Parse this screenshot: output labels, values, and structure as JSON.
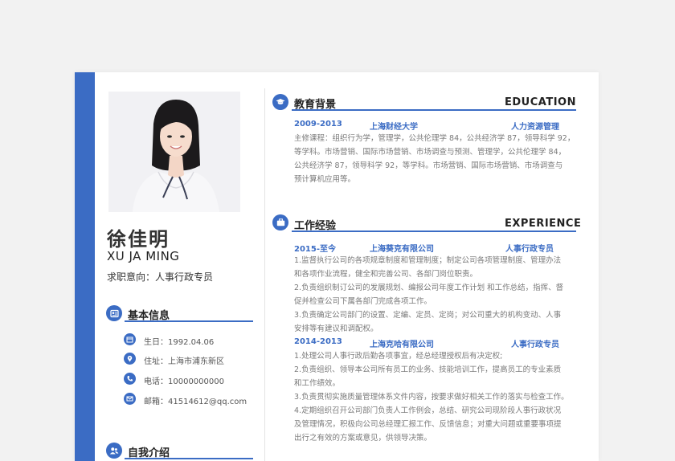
{
  "profile": {
    "name_cn": "徐佳明",
    "name_en": "XU JA MING",
    "intention": "求职意向：人事行政专员"
  },
  "basic_info": {
    "title": "基本信息",
    "items": [
      {
        "icon": "calendar-icon",
        "text": "生日：1992.04.06"
      },
      {
        "icon": "location-icon",
        "text": "住址：上海市浦东新区"
      },
      {
        "icon": "phone-icon",
        "text": "电话：10000000000"
      },
      {
        "icon": "email-icon",
        "text": "邮箱：41514612@qq.com"
      }
    ]
  },
  "self_intro": {
    "title": "自我介绍"
  },
  "education": {
    "title_cn": "教育背景",
    "title_en": "EDUCATION",
    "period": "2009-2013",
    "school": "上海财经大学",
    "major": "人力资源管理",
    "lines": [
      "主修课程：组织行为学，管理学，公共伦理学 84，公共经济学 87，领导科学 92，",
      "等学科。市场营销、国际市场营销、市场调查与预测、管理学，公共伦理学 84，",
      "公共经济学 87，领导科学 92，等学科。市场营销、国际市场营销、市场调查与",
      "预计算机应用等。"
    ]
  },
  "work": {
    "title_cn": "工作经验",
    "title_en": "EXPERIENCE",
    "jobs": [
      {
        "period": "2015-至今",
        "company": "上海葵克有限公司",
        "position": "人事行政专员",
        "lines": [
          "1.监督执行公司的各项规章制度和管理制度；制定公司各项管理制度、管理办法",
          "和各项作业流程，健全和完善公司、各部门岗位职责。",
          "2.负责组织制订公司的发展规划、编报公司年度工作计划 和工作总结，指挥、督",
          "促并检查公司下属各部门完成各项工作。",
          "3.负责确定公司部门的设置、定编、定员、定岗；对公司重大的机构变动、人事",
          "安排等有建议和调配权。"
        ]
      },
      {
        "period": "2014-2013",
        "company": "上海克哈有限公司",
        "position": "人事行政专员",
        "lines": [
          "1.处理公司人事行政后勤各项事宜，经总经理授权后有决定权;",
          "2.负责组织、领导本公司所有员工的业务、技能培训工作，提高员工的专业素质",
          "和工作绩效。",
          "3.负责贯彻实施质量管理体系文件内容，按要求做好相关工作的落实与检查工作。",
          "4.定期组织召开公司部门负责人工作例会，总结、研究公司现阶段人事行政状况",
          "及管理情况，积极向公司总经理汇报工作、反馈信息；对重大问题或重要事项提",
          "出行之有效的方案或意见，供领导决策。"
        ]
      }
    ]
  },
  "colors": {
    "accent": "#3b6cc4",
    "text": "#7a7a7a",
    "heading": "#222222"
  }
}
